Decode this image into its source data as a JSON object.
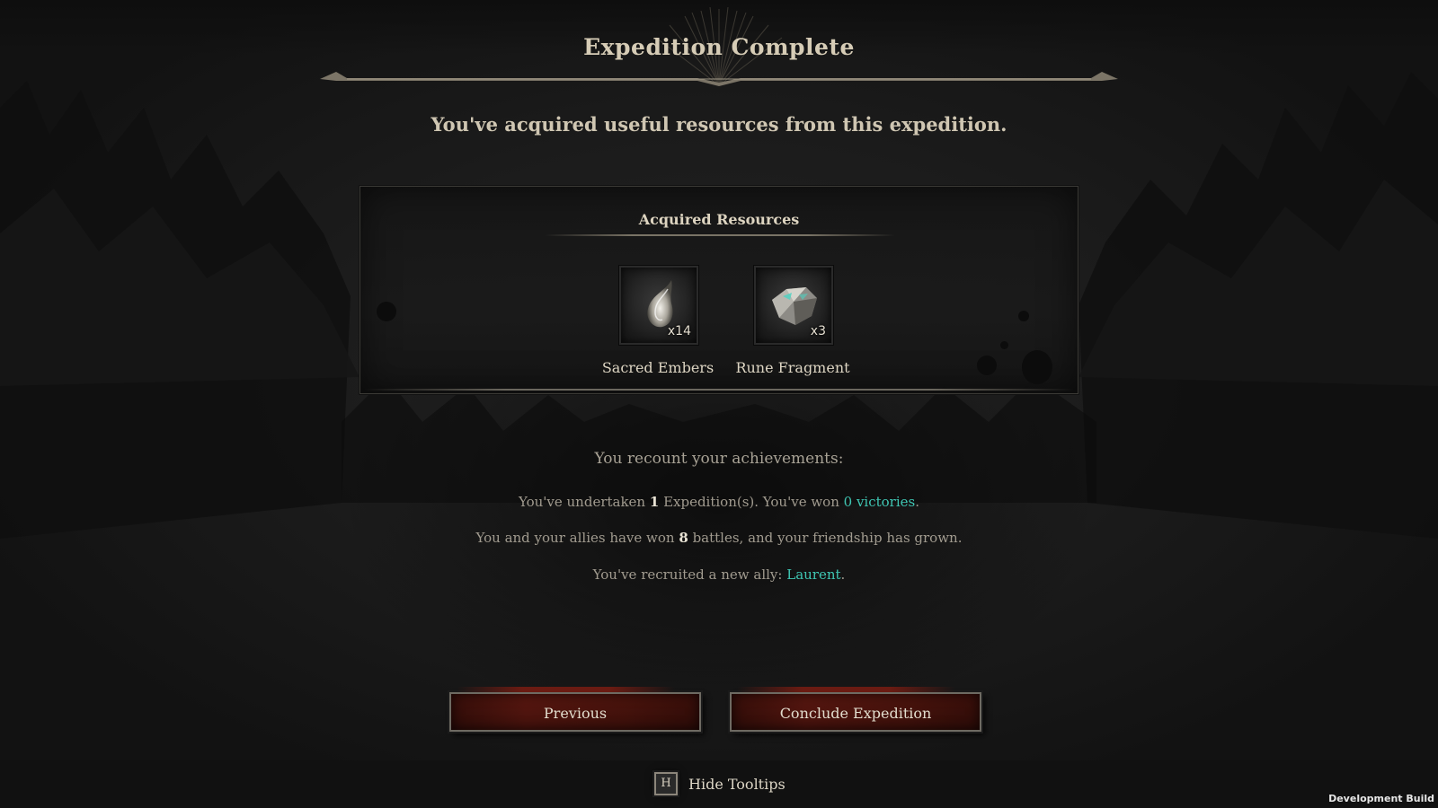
{
  "header": {
    "title": "Expedition Complete",
    "subtitle": "You've acquired useful resources from this expedition."
  },
  "resources": {
    "heading": "Acquired Resources",
    "items": [
      {
        "name": "Sacred Embers",
        "count": "x14",
        "icon": "sacred-ember-icon"
      },
      {
        "name": "Rune Fragment",
        "count": "x3",
        "icon": "rune-fragment-icon"
      }
    ]
  },
  "achievements": {
    "heading": "You recount your achievements:",
    "expeditions": {
      "prefix": "You've undertaken ",
      "count": "1",
      "middle": " Expedition(s). You've won ",
      "victories": "0 victories",
      "suffix": "."
    },
    "battles": {
      "prefix": "You and your allies have won ",
      "count": "8",
      "suffix": " battles, and your friendship has grown."
    },
    "ally": {
      "prefix": "You've recruited a new ally: ",
      "name": "Laurent",
      "suffix": "."
    }
  },
  "buttons": {
    "previous": "Previous",
    "conclude": "Conclude Expedition"
  },
  "footer": {
    "hotkey": "H",
    "hide_tooltips": "Hide Tooltips",
    "build_label": "Development Build"
  },
  "colors": {
    "highlight": "#3fc6b3",
    "button_red": "#5a1710",
    "text_primary": "#d6ccb6"
  }
}
